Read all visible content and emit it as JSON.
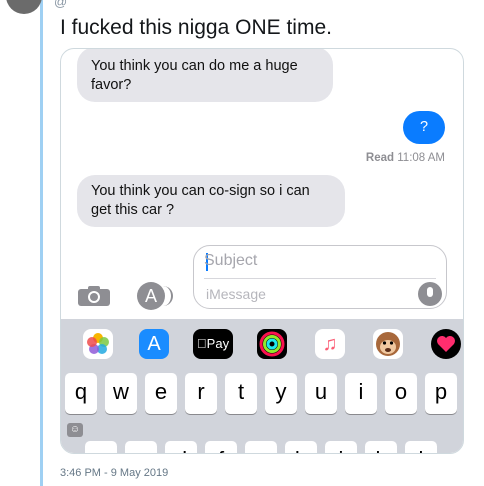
{
  "tweet": {
    "text": "I fucked this nigga ONE time.",
    "timestamp": "3:46 PM - 9 May 2019",
    "handle": "@"
  },
  "messages": [
    {
      "side": "in",
      "text": "You think you can do me a huge favor?"
    },
    {
      "side": "out",
      "text": "?"
    },
    {
      "side": "in",
      "text": "You think you can co-sign so i can get this car ?"
    }
  ],
  "read_receipt": {
    "label": "Read",
    "time": "11:08 AM"
  },
  "composer": {
    "subject_placeholder": "Subject",
    "message_placeholder": "iMessage"
  },
  "app_drawer": [
    {
      "icon": "photos-icon",
      "color": "#ffffff"
    },
    {
      "icon": "app-store-icon",
      "color": "#1a8cff"
    },
    {
      "icon": "apple-pay-icon",
      "label": "Pay",
      "color": "#000000"
    },
    {
      "icon": "activity-rings-icon",
      "color": "#000000"
    },
    {
      "icon": "music-icon",
      "color": "#ffffff"
    },
    {
      "icon": "monkey-animoji-icon",
      "color": "#ffffff"
    },
    {
      "icon": "digital-touch-icon",
      "color": "#000000"
    }
  ],
  "keyboard": {
    "row1": [
      "q",
      "w",
      "e",
      "r",
      "t",
      "y",
      "u",
      "i",
      "o",
      "p"
    ],
    "row2": [
      "a",
      "s",
      "d",
      "f",
      "g",
      "h",
      "j",
      "k",
      "l"
    ]
  }
}
